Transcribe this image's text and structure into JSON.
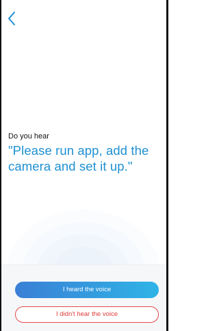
{
  "nav": {
    "back_icon": "chevron-left-icon",
    "accent_color": "#1e90d2"
  },
  "prompt": {
    "label": "Do you hear",
    "text": "\"Please run app, add the camera and set it up.\""
  },
  "actions": {
    "heard_label": "I heard the voice",
    "not_heard_label": "I didn't hear the voice",
    "primary_gradient_start": "#3a7fd6",
    "primary_gradient_end": "#2fb4e6",
    "secondary_color": "#e03c3c"
  }
}
